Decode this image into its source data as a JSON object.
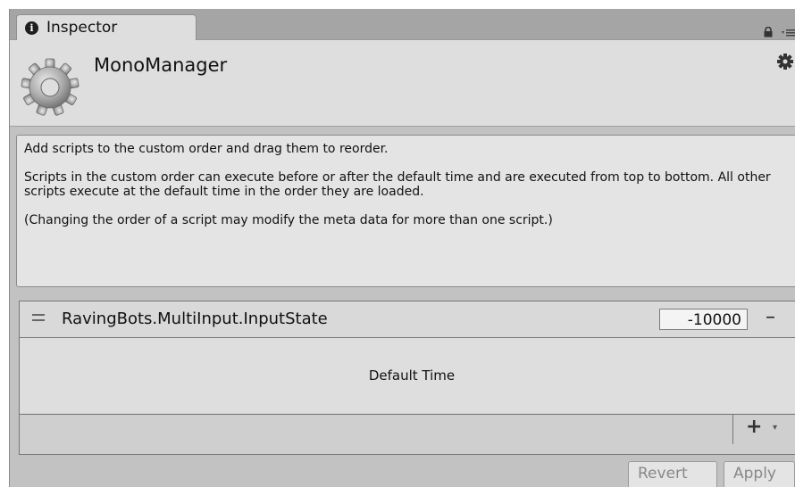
{
  "tab": {
    "label": "Inspector",
    "icon": "info-icon"
  },
  "header": {
    "title": "MonoManager",
    "icon": "gear-cog-icon"
  },
  "help": {
    "paragraphs": [
      "Add scripts to the custom order and drag them to reorder.",
      "Scripts in the custom order can execute before or after the default time and are executed from top to bottom. All other scripts execute at the default time in the order they are loaded.",
      "(Changing the order of a script may modify the meta data for more than one script.)"
    ]
  },
  "list": {
    "rows": [
      {
        "name": "RavingBots.MultiInput.InputState",
        "order": "-10000",
        "remove_label": "–"
      }
    ],
    "default_time_label": "Default Time",
    "add_label": "+",
    "add_arrow": "▾"
  },
  "buttons": {
    "revert": "Revert",
    "apply": "Apply"
  }
}
